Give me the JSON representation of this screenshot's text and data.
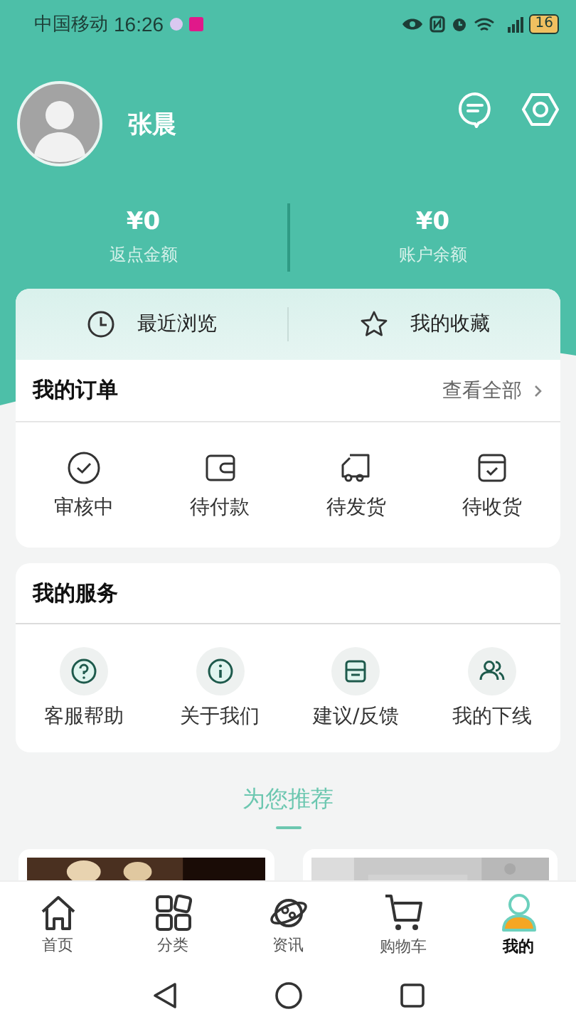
{
  "status_bar": {
    "carrier": "中国移动",
    "time": "16:26",
    "battery": "16"
  },
  "profile": {
    "name": "张晨"
  },
  "balances": [
    {
      "amount": "¥0",
      "label": "返点金额"
    },
    {
      "amount": "¥0",
      "label": "账户余额"
    }
  ],
  "quick_links": [
    {
      "kind": "clock",
      "label": "最近浏览"
    },
    {
      "kind": "star",
      "label": "我的收藏"
    }
  ],
  "orders": {
    "title": "我的订单",
    "view_all": "查看全部",
    "items": [
      {
        "kind": "review",
        "label": "审核中"
      },
      {
        "kind": "wallet",
        "label": "待付款"
      },
      {
        "kind": "truck",
        "label": "待发货"
      },
      {
        "kind": "box",
        "label": "待收货"
      }
    ]
  },
  "services": {
    "title": "我的服务",
    "items": [
      {
        "kind": "help",
        "label": "客服帮助"
      },
      {
        "kind": "info",
        "label": "关于我们"
      },
      {
        "kind": "feedback",
        "label": "建议/反馈"
      },
      {
        "kind": "team",
        "label": "我的下线"
      }
    ]
  },
  "recommend": {
    "title": "为您推荐"
  },
  "tab_bar": [
    {
      "kind": "home",
      "label": "首页",
      "selected": false
    },
    {
      "kind": "grid",
      "label": "分类",
      "selected": false
    },
    {
      "kind": "planet",
      "label": "资讯",
      "selected": false
    },
    {
      "kind": "cart",
      "label": "购物车",
      "selected": false
    },
    {
      "kind": "user",
      "label": "我的",
      "selected": true
    }
  ]
}
